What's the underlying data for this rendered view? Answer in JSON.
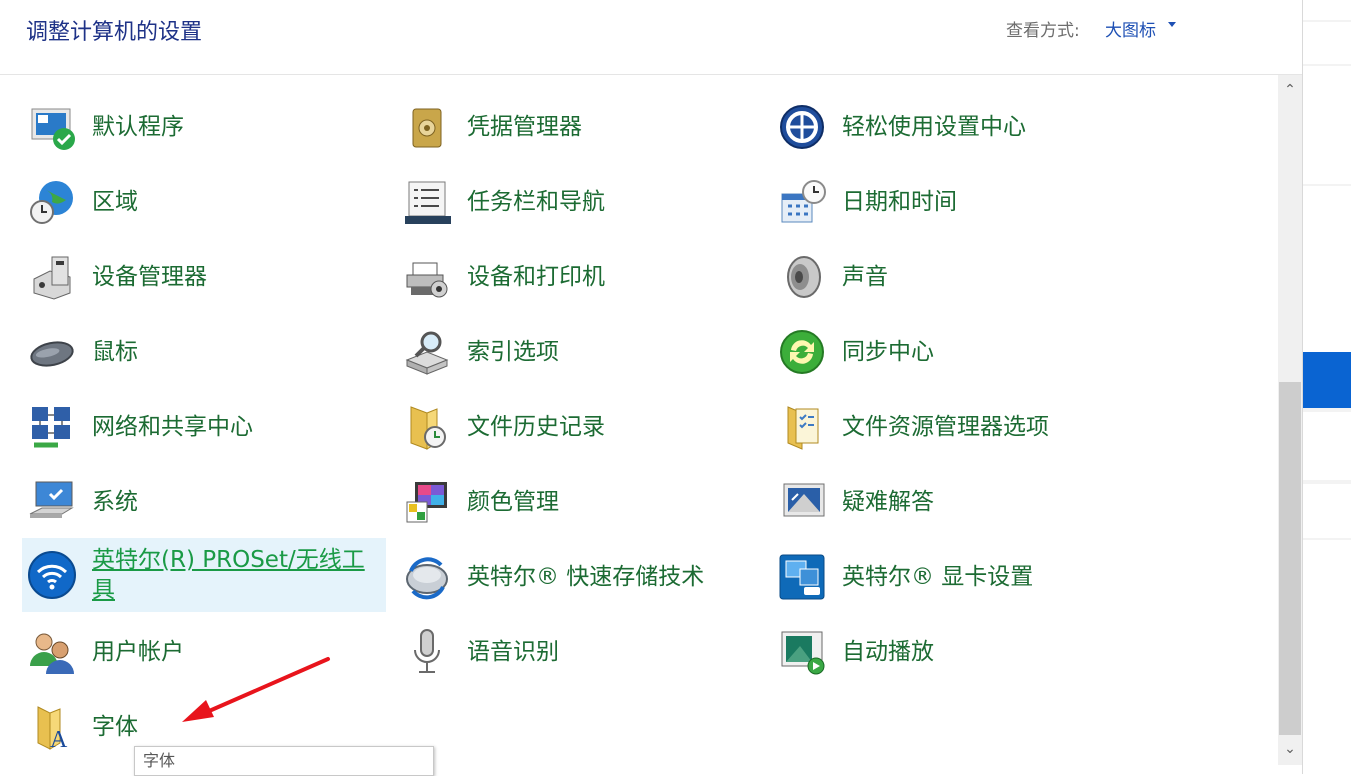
{
  "header": {
    "title": "调整计算机的设置",
    "view_label": "查看方式:",
    "view_value": "大图标"
  },
  "items": [
    {
      "label": "默认程序",
      "icon": "default-programs-icon"
    },
    {
      "label": "凭据管理器",
      "icon": "credential-manager-icon"
    },
    {
      "label": "轻松使用设置中心",
      "icon": "ease-of-access-icon"
    },
    {
      "label": "区域",
      "icon": "region-globe-icon"
    },
    {
      "label": "任务栏和导航",
      "icon": "taskbar-icon"
    },
    {
      "label": "日期和时间",
      "icon": "date-time-icon"
    },
    {
      "label": "设备管理器",
      "icon": "device-manager-icon"
    },
    {
      "label": "设备和打印机",
      "icon": "printer-icon"
    },
    {
      "label": "声音",
      "icon": "speaker-icon"
    },
    {
      "label": "鼠标",
      "icon": "mouse-icon"
    },
    {
      "label": "索引选项",
      "icon": "indexing-icon"
    },
    {
      "label": "同步中心",
      "icon": "sync-icon"
    },
    {
      "label": "网络和共享中心",
      "icon": "network-icon"
    },
    {
      "label": "文件历史记录",
      "icon": "file-history-icon"
    },
    {
      "label": "文件资源管理器选项",
      "icon": "folder-options-icon"
    },
    {
      "label": "系统",
      "icon": "system-icon"
    },
    {
      "label": "颜色管理",
      "icon": "color-management-icon"
    },
    {
      "label": "疑难解答",
      "icon": "troubleshooting-icon"
    },
    {
      "label": "英特尔(R) PROSet/无线工具",
      "icon": "wireless-icon"
    },
    {
      "label": "英特尔® 快速存储技术",
      "icon": "rapid-storage-icon"
    },
    {
      "label": "英特尔® 显卡设置",
      "icon": "graphics-settings-icon"
    },
    {
      "label": "用户帐户",
      "icon": "user-accounts-icon"
    },
    {
      "label": "语音识别",
      "icon": "microphone-icon"
    },
    {
      "label": "自动播放",
      "icon": "autoplay-icon"
    },
    {
      "label": "字体",
      "icon": "fonts-icon"
    }
  ],
  "tooltip": "字体",
  "colors": {
    "title": "#1e3287",
    "link": "#1c6b33",
    "hover_bg": "#e5f3fb",
    "arrow": "#e8141c"
  }
}
